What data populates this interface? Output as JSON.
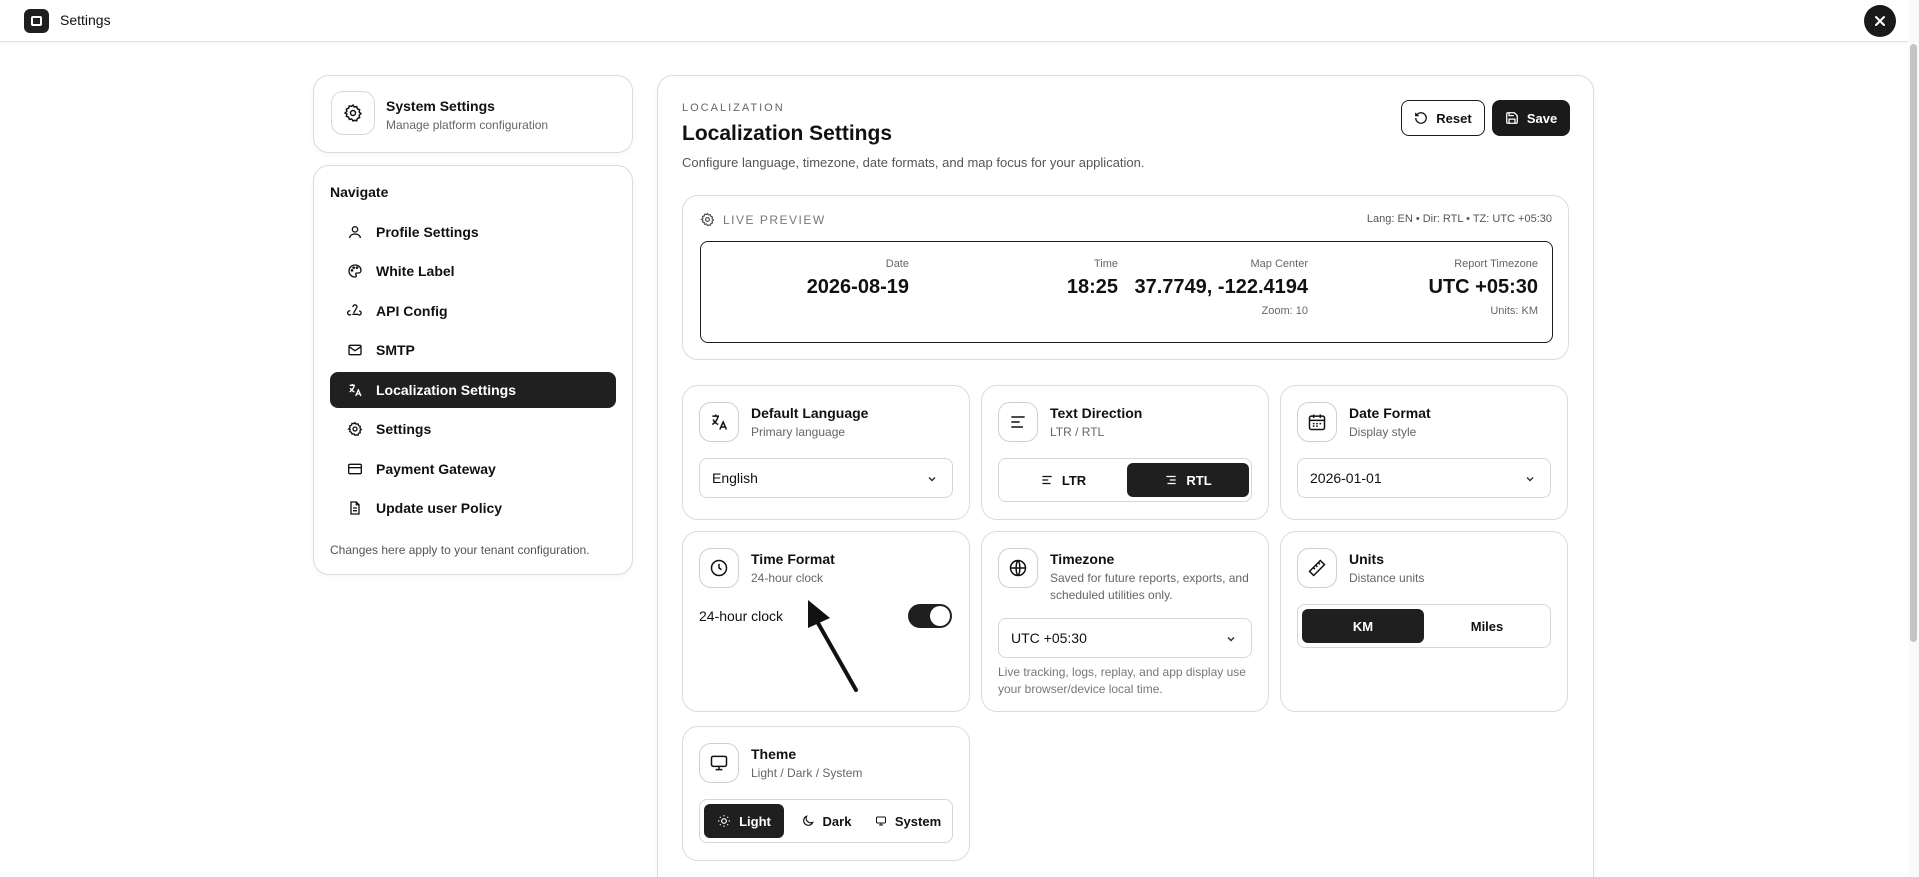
{
  "topbar": {
    "title": "Settings"
  },
  "system_card": {
    "title": "System Settings",
    "subtitle": "Manage platform configuration"
  },
  "nav": {
    "heading": "Navigate",
    "items": [
      {
        "label": "Profile Settings",
        "icon": "user-icon"
      },
      {
        "label": "White Label",
        "icon": "palette-icon"
      },
      {
        "label": "API Config",
        "icon": "webhook-icon"
      },
      {
        "label": "SMTP",
        "icon": "mail-icon"
      },
      {
        "label": "Localization Settings",
        "icon": "languages-icon",
        "active": true
      },
      {
        "label": "Settings",
        "icon": "gear-icon"
      },
      {
        "label": "Payment Gateway",
        "icon": "credit-card-icon"
      },
      {
        "label": "Update user Policy",
        "icon": "file-text-icon"
      }
    ],
    "footer": "Changes here apply to your tenant configuration."
  },
  "main": {
    "eyebrow": "LOCALIZATION",
    "title": "Localization Settings",
    "subtitle": "Configure language, timezone, date formats, and map focus for your application.",
    "reset_label": "Reset",
    "save_label": "Save"
  },
  "preview": {
    "label": "LIVE PREVIEW",
    "meta": "Lang: EN • Dir: RTL • TZ: UTC +05:30",
    "date_label": "Date",
    "date_value": "2026-08-19",
    "time_label": "Time",
    "time_value": "18:25",
    "map_label": "Map Center",
    "map_value": "37.7749, -122.4194",
    "zoom": "Zoom: 10",
    "tz_label": "Report Timezone",
    "tz_value": "UTC +05:30",
    "units": "Units: KM"
  },
  "cards": {
    "language": {
      "title": "Default Language",
      "subtitle": "Primary language",
      "value": "English"
    },
    "direction": {
      "title": "Text Direction",
      "subtitle": "LTR / RTL",
      "ltr": "LTR",
      "rtl": "RTL",
      "selected": "RTL"
    },
    "date_format": {
      "title": "Date Format",
      "subtitle": "Display style",
      "value": "2026-01-01"
    },
    "time_format": {
      "title": "Time Format",
      "subtitle": "24-hour clock",
      "toggle_label": "24-hour clock",
      "toggle_on": true
    },
    "timezone": {
      "title": "Timezone",
      "subtitle": "Saved for future reports, exports, and scheduled utilities only.",
      "value": "UTC +05:30",
      "note": "Live tracking, logs, replay, and app display use your browser/device local time."
    },
    "units": {
      "title": "Units",
      "subtitle": "Distance units",
      "km": "KM",
      "miles": "Miles",
      "selected": "KM"
    },
    "theme": {
      "title": "Theme",
      "subtitle": "Light / Dark / System",
      "light": "Light",
      "dark": "Dark",
      "system": "System",
      "selected": "Light"
    }
  }
}
